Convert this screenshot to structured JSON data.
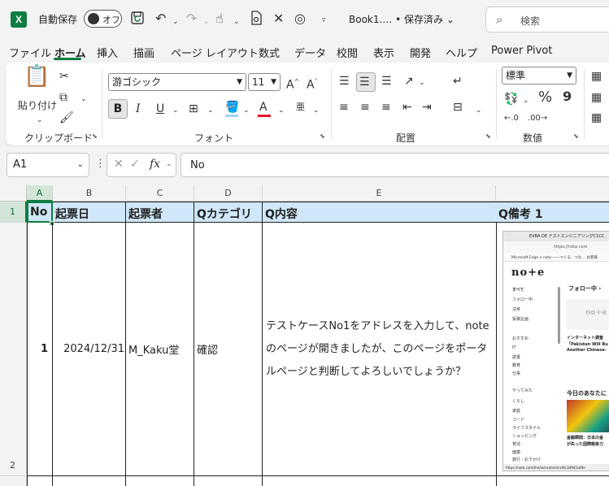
{
  "titlebar": {
    "logo": "X",
    "autosave_label": "自動保存",
    "autosave_state": "オフ",
    "doc_title": "Book1.…  • 保存済み ⌄",
    "search_placeholder": "検索"
  },
  "tabs": [
    "ファイル",
    "ホーム",
    "挿入",
    "描画",
    "ページ レイアウト",
    "数式",
    "データ",
    "校閲",
    "表示",
    "開発",
    "ヘルプ",
    "Power Pivot"
  ],
  "ribbon": {
    "clipboard": {
      "paste_label": "貼り付け",
      "group_label": "クリップボード"
    },
    "font": {
      "font_name": "游ゴシック",
      "font_size": "11",
      "group_label": "フォント",
      "bold": "B",
      "italic": "I",
      "underline": "U",
      "grow": "A^",
      "shrink": "A˅",
      "font_color_letter": "A",
      "phonetic": "亜"
    },
    "alignment": {
      "group_label": "配置"
    },
    "number": {
      "format": "標準",
      "percent": "%",
      "comma": "9",
      "group_label": "数値"
    },
    "accent_color": "#107c41"
  },
  "formula_bar": {
    "name_box": "A1",
    "fx_label": "fx",
    "formula": "No"
  },
  "grid": {
    "columns": [
      "A",
      "B",
      "C",
      "D",
      "E"
    ],
    "rows": [
      "1",
      "2"
    ],
    "header_row": [
      "No",
      "起票日",
      "起票者",
      "Qカテゴリ",
      "Q内容",
      "Q備考 1"
    ],
    "data_row": {
      "no": "1",
      "date": "2024/12/31",
      "author": "M_Kaku堂",
      "category": "確認",
      "content": "テストケースNo1をアドレスを入力して、noteのページが開きましたが、このページをポータルページと判断してよろしいでしょうか？"
    },
    "header_fill": "#cfe7f8"
  },
  "embedded_screenshot": {
    "tab_title": "EVBA DE テストエンジニアリングC1CC",
    "url": "https://note.com",
    "bookmarks": "Microsoft Edge   n note ――つくる、つな…   お客様",
    "logo": "no+e",
    "side_items": [
      "すべて",
      "フォロー中",
      "注目",
      "投稿企画",
      "おすすめ",
      "IT",
      "読書",
      "教育",
      "仕事",
      "やってみた",
      "くらし",
      "家庭",
      "コード",
      "ライフスタイル",
      "ショッピング",
      "育児",
      "健康",
      "旅行・おでかけ"
    ],
    "follow_label": "フォロー中 ›",
    "card_logo": "no+e",
    "article1": [
      "インターネット調査",
      "「Pakistan Will Bu",
      "Another Chinese-"
    ],
    "today_label": "今日のあなたに",
    "article2": [
      "金融瞬間：日本の金",
      "が失った国際競争力"
    ],
    "status_url": "https://note.com/the/lachcats/n/ncf6c3d945c89e"
  }
}
